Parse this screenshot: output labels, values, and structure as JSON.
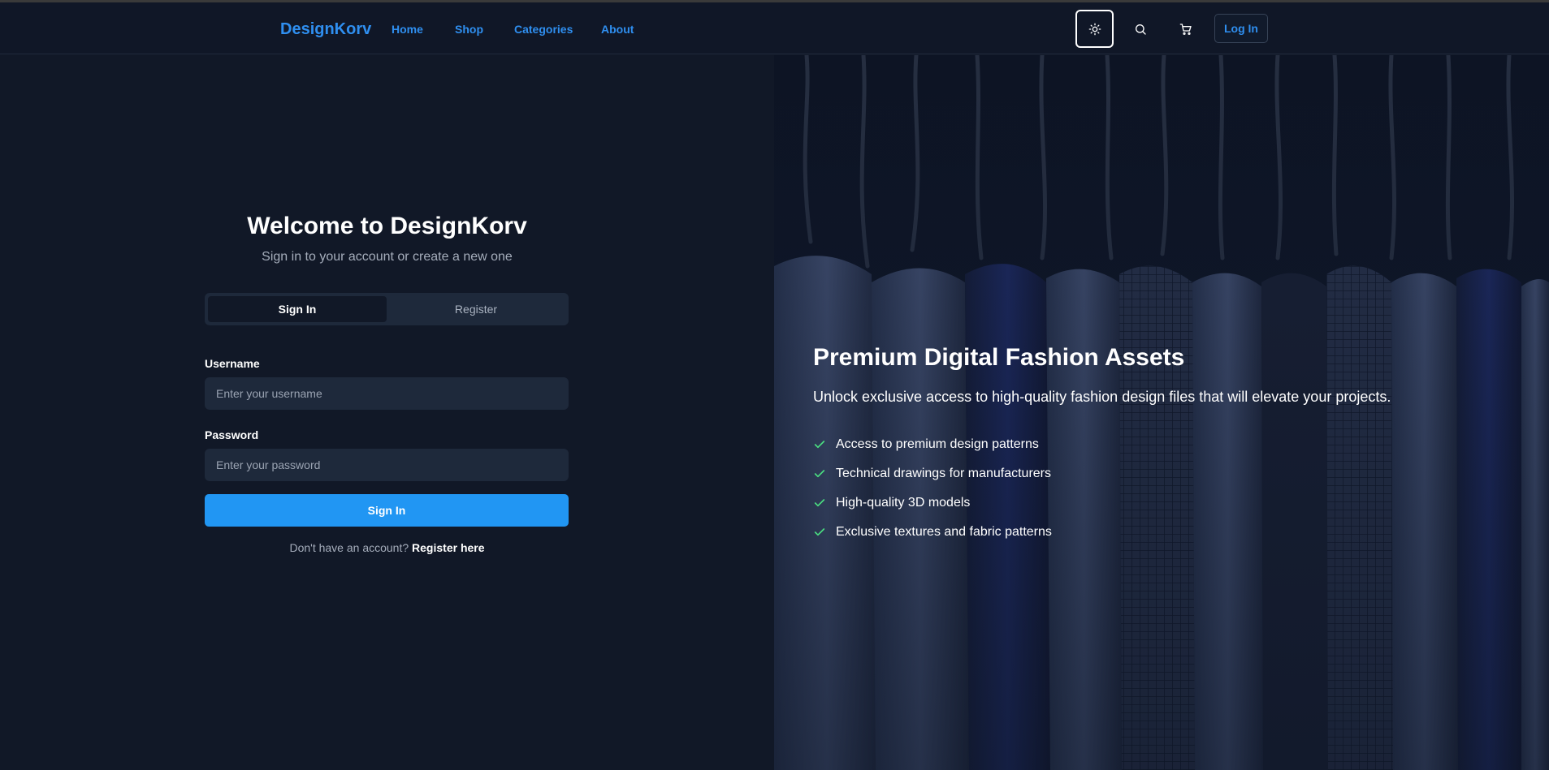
{
  "nav": {
    "brand": "DesignKorv",
    "links": [
      "Home",
      "Shop",
      "Categories",
      "About"
    ],
    "login_label": "Log In",
    "icons": [
      "sun-icon",
      "search-icon",
      "cart-icon"
    ]
  },
  "auth": {
    "title": "Welcome to DesignKorv",
    "subtitle": "Sign in to your account or create a new one",
    "tabs": [
      "Sign In",
      "Register"
    ],
    "active_tab": "Sign In",
    "username_label": "Username",
    "username_placeholder": "Enter your username",
    "password_label": "Password",
    "password_placeholder": "Enter your password",
    "submit_label": "Sign In",
    "footer_text": "Don't have an account?",
    "footer_link": "Register here"
  },
  "hero": {
    "title": "Premium Digital Fashion Assets",
    "subtitle": "Unlock exclusive access to high-quality fashion design files that will elevate your projects.",
    "features": [
      "Access to premium design patterns",
      "Technical drawings for manufacturers",
      "High-quality 3D models",
      "Exclusive textures and fabric patterns"
    ],
    "check_color": "#4ade80"
  },
  "colors": {
    "accent": "#2196f3",
    "link": "#2f8ff0",
    "background": "#111827",
    "input_bg": "#1e293b"
  }
}
